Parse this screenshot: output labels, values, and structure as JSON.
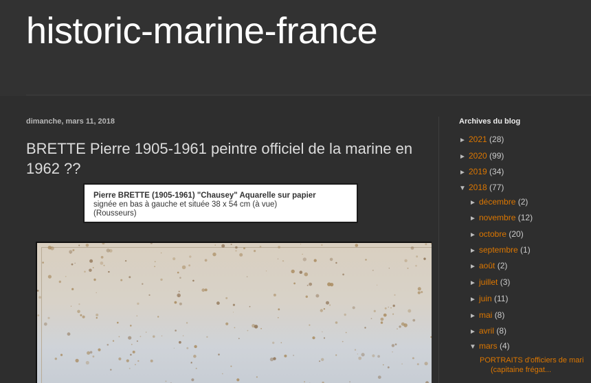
{
  "header": {
    "blog_title": "historic-marine-france"
  },
  "post": {
    "date": "dimanche, mars 11, 2018",
    "title": "BRETTE Pierre 1905-1961 peintre officiel de la marine en 1962 ??",
    "caption_line1": "Pierre BRETTE (1905-1961) \"Chausey\" Aquarelle sur papier",
    "caption_line2": "signée en bas à gauche et située 38 x 54 cm (à vue)",
    "caption_line3": "(Rousseurs)"
  },
  "sidebar": {
    "title": "Archives du blog",
    "years": [
      {
        "label": "2021",
        "count": "(28)",
        "toggle": "►"
      },
      {
        "label": "2020",
        "count": "(99)",
        "toggle": "►"
      },
      {
        "label": "2019",
        "count": "(34)",
        "toggle": "►"
      },
      {
        "label": "2018",
        "count": "(77)",
        "toggle": "▼"
      }
    ],
    "months": [
      {
        "label": "décembre",
        "count": "(2)",
        "toggle": "►"
      },
      {
        "label": "novembre",
        "count": "(12)",
        "toggle": "►"
      },
      {
        "label": "octobre",
        "count": "(20)",
        "toggle": "►"
      },
      {
        "label": "septembre",
        "count": "(1)",
        "toggle": "►"
      },
      {
        "label": "août",
        "count": "(2)",
        "toggle": "►"
      },
      {
        "label": "juillet",
        "count": "(3)",
        "toggle": "►"
      },
      {
        "label": "juin",
        "count": "(11)",
        "toggle": "►"
      },
      {
        "label": "mai",
        "count": "(8)",
        "toggle": "►"
      },
      {
        "label": "avril",
        "count": "(8)",
        "toggle": "►"
      },
      {
        "label": "mars",
        "count": "(4)",
        "toggle": "▼"
      }
    ],
    "post_link_line1": "PORTRAITS d'officiers de mari",
    "post_link_line2": "(capitaine frégat..."
  },
  "colors": {
    "background": "#2e2e2e",
    "link": "#dd7700",
    "title": "#ffffff"
  }
}
